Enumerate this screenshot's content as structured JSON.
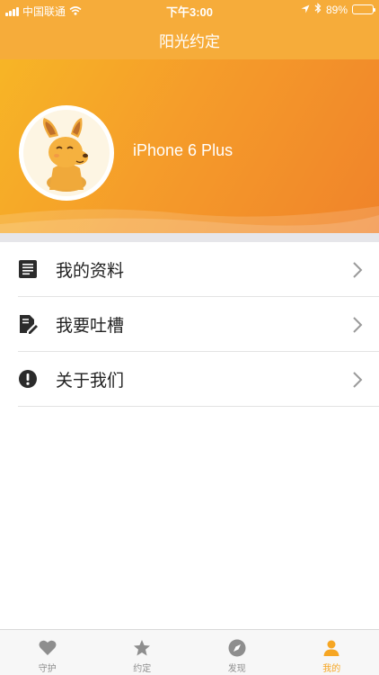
{
  "status_bar": {
    "carrier": "中国联通",
    "time": "下午3:00",
    "battery": "89%",
    "battery_level": 0.89
  },
  "nav": {
    "title": "阳光约定"
  },
  "profile": {
    "username": "iPhone 6 Plus",
    "avatar_icon": "kangaroo-avatar"
  },
  "menu": {
    "items": [
      {
        "label": "我的资料",
        "icon": "document-icon"
      },
      {
        "label": "我要吐槽",
        "icon": "edit-note-icon"
      },
      {
        "label": "关于我们",
        "icon": "exclamation-icon"
      }
    ]
  },
  "tabbar": {
    "items": [
      {
        "label": "守护",
        "icon": "heart-icon",
        "active": false
      },
      {
        "label": "约定",
        "icon": "star-icon",
        "active": false
      },
      {
        "label": "发现",
        "icon": "compass-icon",
        "active": false
      },
      {
        "label": "我的",
        "icon": "person-icon",
        "active": true
      }
    ]
  },
  "colors": {
    "accent": "#f6a623",
    "header": "#f6ac3a",
    "tab_inactive": "#8e8e8e"
  }
}
